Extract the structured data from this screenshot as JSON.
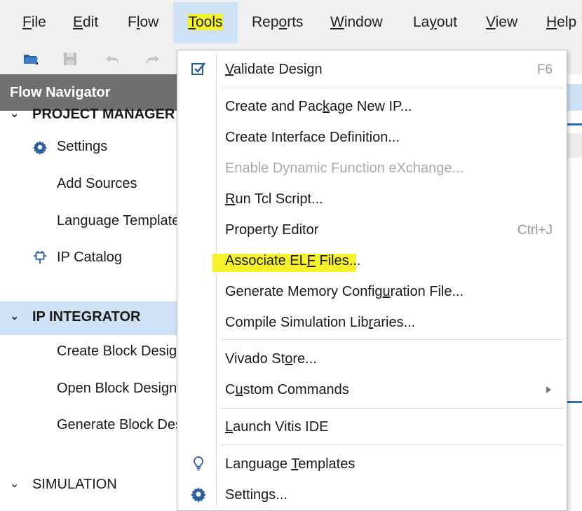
{
  "menubar": {
    "items": [
      {
        "label": "File",
        "mnemonic": "F",
        "rest": "ile"
      },
      {
        "label": "Edit",
        "mnemonic": "E",
        "rest": "dit"
      },
      {
        "label": "Flow",
        "pre": "F",
        "mnemonic": "l",
        "rest": "ow"
      },
      {
        "label": "Tools",
        "mnemonic": "T",
        "rest": "ools"
      },
      {
        "label": "Reports",
        "pre": "Rep",
        "mnemonic": "o",
        "rest": "rts"
      },
      {
        "label": "Window",
        "mnemonic": "W",
        "rest": "indow"
      },
      {
        "label": "Layout",
        "pre": "La",
        "mnemonic": "y",
        "rest": "out"
      },
      {
        "label": "View",
        "mnemonic": "V",
        "rest": "iew"
      },
      {
        "label": "Help",
        "mnemonic": "H",
        "rest": "elp"
      }
    ]
  },
  "flow_navigator": {
    "title": "Flow Navigator",
    "project_manager": {
      "label": "PROJECT MANAGER",
      "items": [
        "Settings",
        "Add Sources",
        "Language Templates",
        "IP Catalog"
      ]
    },
    "ip_integrator": {
      "label": "IP INTEGRATOR",
      "items": [
        "Create Block Design",
        "Open Block Design",
        "Generate Block Design"
      ]
    },
    "simulation": {
      "label": "SIMULATION"
    }
  },
  "tools_menu": {
    "validate": {
      "pre": "",
      "u": "V",
      "post": "alidate Design",
      "shortcut": "F6"
    },
    "create_package": {
      "pre": "Create and Pac",
      "u": "k",
      "post": "age New IP..."
    },
    "create_interface": {
      "label": "Create Interface Definition..."
    },
    "enable_dfx": {
      "label": "Enable Dynamic Function eXchange..."
    },
    "run_tcl": {
      "pre": "",
      "u": "R",
      "post": "un Tcl Script..."
    },
    "property_editor": {
      "label": "Property Editor",
      "shortcut": "Ctrl+J"
    },
    "associate_elf": {
      "pre": "Associate EL",
      "u": "F",
      "post": " Files..."
    },
    "gen_memory": {
      "pre": "Generate Memory Config",
      "u": "u",
      "post": "ration File..."
    },
    "compile_sim": {
      "pre": "Compile Simulation Lib",
      "u": "r",
      "post": "aries..."
    },
    "vivado_store": {
      "pre": "Vivado St",
      "u": "o",
      "post": "re..."
    },
    "custom_commands": {
      "pre": "C",
      "u": "u",
      "post": "stom Commands"
    },
    "launch_vitis": {
      "pre": "",
      "u": "L",
      "post": "aunch Vitis IDE"
    },
    "language_templates": {
      "pre": "Language ",
      "u": "T",
      "post": "emplates"
    },
    "settings": {
      "label": "Settings..."
    }
  },
  "colors": {
    "menu_open_bg": "#cfe1f5",
    "highlight": "#f5f22a",
    "navigator_header": "#707070",
    "accent_blue": "#2c6db5"
  }
}
